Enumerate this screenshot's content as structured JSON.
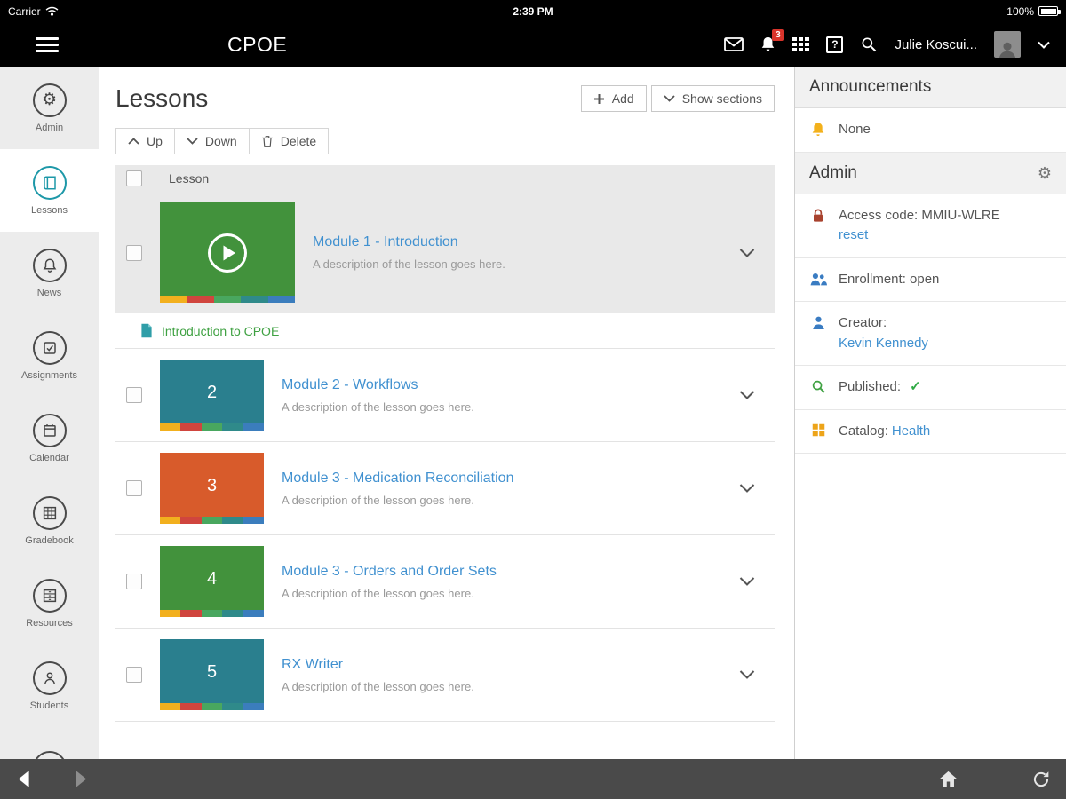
{
  "status_bar": {
    "carrier": "Carrier",
    "time": "2:39 PM",
    "battery_percent": "100%"
  },
  "header": {
    "title": "CPOE",
    "notification_badge": "3",
    "help_label": "?",
    "user_name": "Julie Koscui..."
  },
  "icons": {
    "gear": "⚙",
    "check": "✓"
  },
  "sidebar": {
    "items": [
      {
        "label": "Admin",
        "active": false
      },
      {
        "label": "Lessons",
        "active": true
      },
      {
        "label": "News",
        "active": false
      },
      {
        "label": "Assignments",
        "active": false
      },
      {
        "label": "Calendar",
        "active": false
      },
      {
        "label": "Gradebook",
        "active": false
      },
      {
        "label": "Resources",
        "active": false
      },
      {
        "label": "Students",
        "active": false
      }
    ]
  },
  "main": {
    "title": "Lessons",
    "add_button": "Add",
    "show_sections_button": "Show sections",
    "toolbar": {
      "up": "Up",
      "down": "Down",
      "delete": "Delete"
    },
    "table_header": "Lesson",
    "rows": [
      {
        "title": "Module 1 - Introduction",
        "description": "A description of the lesson goes here.",
        "tile_color": "#42923c",
        "selected": true,
        "sub_item": "Introduction to CPOE"
      },
      {
        "tile_number": "2",
        "title": "Module 2 - Workflows",
        "description": "A description of the lesson goes here.",
        "tile_color": "#2a7f8e"
      },
      {
        "tile_number": "3",
        "title": "Module 3 - Medication Reconciliation",
        "description": "A description of the lesson goes here.",
        "tile_color": "#d85b2b"
      },
      {
        "tile_number": "4",
        "title": "Module 3 - Orders and Order Sets",
        "description": "A description of the lesson goes here.",
        "tile_color": "#42923c"
      },
      {
        "tile_number": "5",
        "title": "RX Writer",
        "description": "A description of the lesson goes here.",
        "tile_color": "#2a7f8e"
      }
    ],
    "stripe_colors": [
      "#f2b01e",
      "#d0453e",
      "#49a75f",
      "#2f8a8a",
      "#3b7dbd"
    ]
  },
  "right_panel": {
    "announcements_title": "Announcements",
    "announcements_none": "None",
    "admin_title": "Admin",
    "access_code": "Access code: MMIU-WLRE",
    "reset_link": "reset",
    "enrollment": "Enrollment: open",
    "creator_label": "Creator:",
    "creator_name": "Kevin Kennedy",
    "published_label": "Published:",
    "catalog_label": "Catalog:",
    "catalog_value": "Health",
    "link_color": "#4191d0"
  }
}
